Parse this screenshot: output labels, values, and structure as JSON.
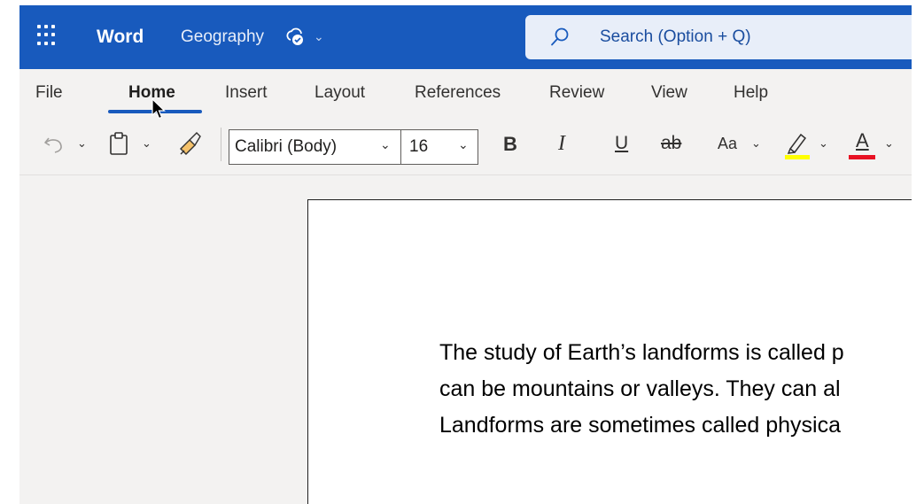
{
  "titlebar": {
    "app_name": "Word",
    "doc_name": "Geography",
    "doc_status_icon": "cloud-saved-icon",
    "search_placeholder": "Search (Option + Q)"
  },
  "ribbon": {
    "tabs": [
      {
        "label": "File",
        "active": false
      },
      {
        "label": "Home",
        "active": true
      },
      {
        "label": "Insert",
        "active": false
      },
      {
        "label": "Layout",
        "active": false
      },
      {
        "label": "References",
        "active": false
      },
      {
        "label": "Review",
        "active": false
      },
      {
        "label": "View",
        "active": false
      },
      {
        "label": "Help",
        "active": false
      }
    ],
    "font_name": "Calibri (Body)",
    "font_size": "16",
    "bold_label": "B",
    "italic_label": "I",
    "underline_label": "U",
    "strike_label": "ab",
    "case_label": "Aa",
    "font_color_label": "A",
    "highlight_color": "#ffff00",
    "font_color": "#e81123"
  },
  "document": {
    "lines": [
      "The study of Earth’s landforms is called p",
      "can be mountains or valleys. They can al",
      "Landforms are sometimes called physica"
    ]
  },
  "colors": {
    "brand": "#185abd",
    "ribbon_bg": "#f3f2f1"
  }
}
